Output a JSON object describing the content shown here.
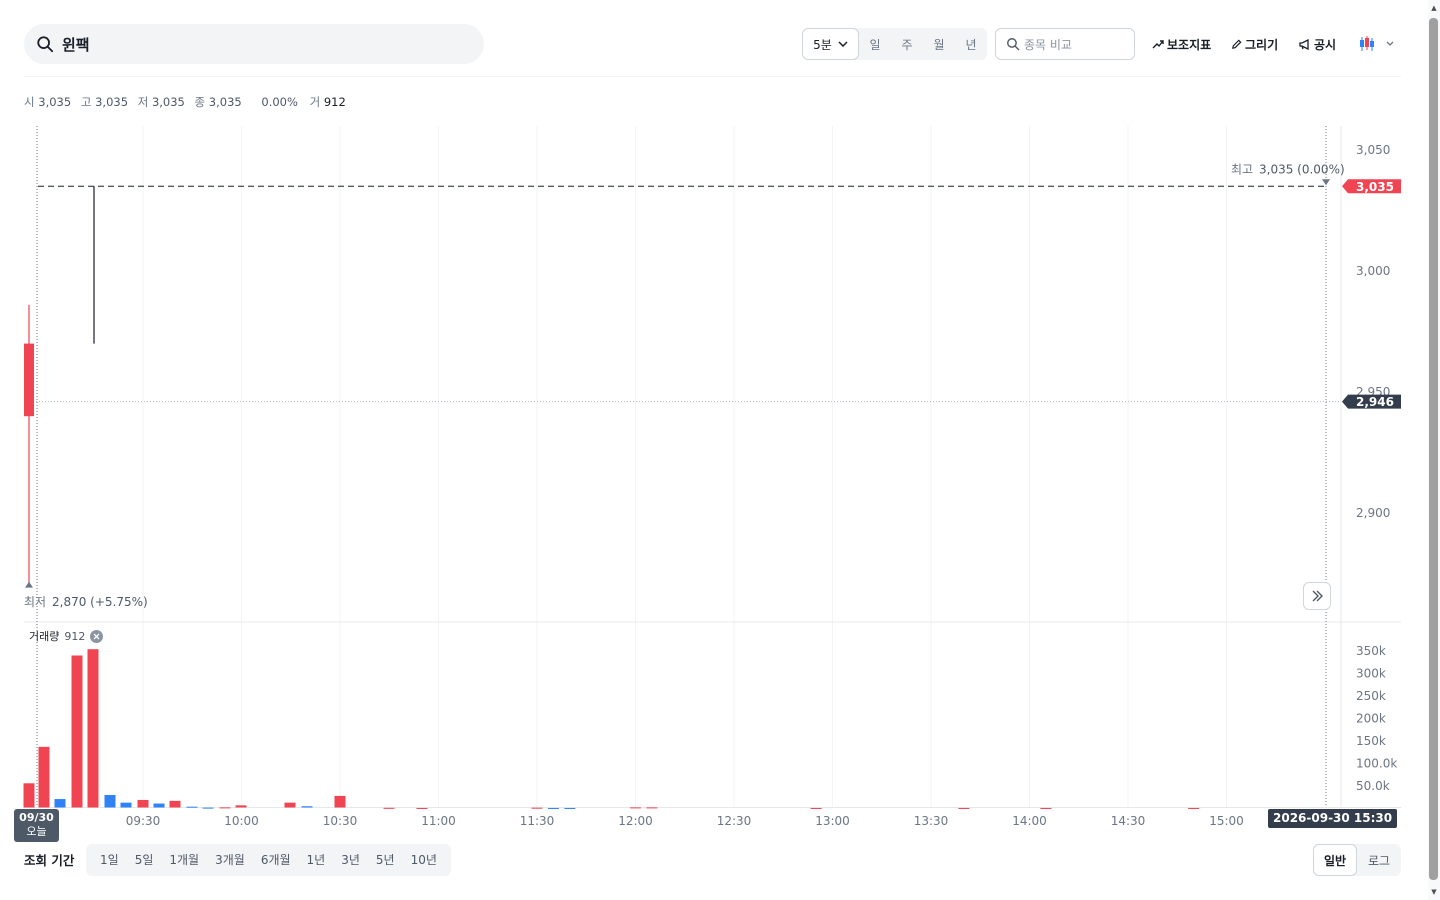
{
  "search": {
    "query": "윈팩"
  },
  "period": {
    "selected": "5분",
    "options": [
      "일",
      "주",
      "월",
      "년"
    ]
  },
  "compare": {
    "placeholder": "종목 비교"
  },
  "tools": {
    "indicator": "보조지표",
    "draw": "그리기",
    "disclosure": "공시"
  },
  "ohlc": {
    "open_label": "시",
    "open": "3,035",
    "high_label": "고",
    "high": "3,035",
    "low_label": "저",
    "low": "3,035",
    "close_label": "종",
    "close": "3,035",
    "change": "0.00%",
    "volume_label": "거",
    "volume": "912"
  },
  "chart_data": {
    "type": "candlestick",
    "price_axis": {
      "ticks": [
        {
          "value": 3050,
          "label": "3,050"
        },
        {
          "value": 3000,
          "label": "3,000"
        },
        {
          "value": 2950,
          "label": "2,950"
        },
        {
          "value": 2900,
          "label": "2,900"
        }
      ]
    },
    "current_price": {
      "value": 2946,
      "label": "2,946"
    },
    "high_marker": {
      "value": 3035,
      "label": "3,035",
      "annotation_label": "최고",
      "annotation_value": "3,035 (0.00%)"
    },
    "low_marker": {
      "value": 2870,
      "label_prefix": "최저",
      "label_value": "2,870 (+5.75%)"
    },
    "time_axis": [
      "09:30",
      "10:00",
      "10:30",
      "11:00",
      "11:30",
      "12:00",
      "12:30",
      "13:00",
      "13:30",
      "14:00",
      "14:30",
      "15:00"
    ],
    "candles": [
      {
        "time": "09:00",
        "open": 2970,
        "high": 2986,
        "low": 2870,
        "close": 2940,
        "color": "red"
      },
      {
        "time": "09:20",
        "open": 3035,
        "high": 3035,
        "low": 2970,
        "close": 3035,
        "color": "black"
      }
    ],
    "volume_axis": {
      "ticks": [
        {
          "value": 350000,
          "label": "350k"
        },
        {
          "value": 300000,
          "label": "300k"
        },
        {
          "value": 250000,
          "label": "250k"
        },
        {
          "value": 200000,
          "label": "200k"
        },
        {
          "value": 150000,
          "label": "150k"
        },
        {
          "value": 100000,
          "label": "100.0k"
        },
        {
          "value": 50000,
          "label": "50.0k"
        }
      ]
    },
    "volume_label": "거래량",
    "volume_value": "912",
    "volume": [
      {
        "time": "09:00",
        "value": 56000,
        "color": "red"
      },
      {
        "time": "09:05",
        "value": 137000,
        "color": "red"
      },
      {
        "time": "09:10",
        "value": 21000,
        "color": "blue"
      },
      {
        "time": "09:15",
        "value": 340000,
        "color": "red"
      },
      {
        "time": "09:20",
        "value": 354000,
        "color": "red"
      },
      {
        "time": "09:25",
        "value": 30000,
        "color": "blue"
      },
      {
        "time": "09:30",
        "value": 13000,
        "color": "blue"
      },
      {
        "time": "09:35",
        "value": 19000,
        "color": "red"
      },
      {
        "time": "09:40",
        "value": 11000,
        "color": "blue"
      },
      {
        "time": "09:45",
        "value": 17000,
        "color": "red"
      },
      {
        "time": "09:50",
        "value": 4000,
        "color": "blue"
      },
      {
        "time": "09:55",
        "value": 2000,
        "color": "blue"
      },
      {
        "time": "10:00",
        "value": 2500,
        "color": "red"
      },
      {
        "time": "10:00",
        "value": 7000,
        "color": "red"
      },
      {
        "time": "10:15",
        "value": 13000,
        "color": "red"
      },
      {
        "time": "10:20",
        "value": 5000,
        "color": "blue"
      },
      {
        "time": "10:30",
        "value": 28000,
        "color": "red"
      },
      {
        "time": "10:40",
        "value": 1500,
        "color": "red"
      },
      {
        "time": "10:50",
        "value": 1200,
        "color": "red"
      },
      {
        "time": "11:30",
        "value": 1800,
        "color": "red"
      },
      {
        "time": "11:35",
        "value": 1200,
        "color": "blue"
      },
      {
        "time": "11:40",
        "value": 1200,
        "color": "blue"
      },
      {
        "time": "12:00",
        "value": 2500,
        "color": "red"
      },
      {
        "time": "12:05",
        "value": 2500,
        "color": "red"
      },
      {
        "time": "12:55",
        "value": 1200,
        "color": "red"
      },
      {
        "time": "13:40",
        "value": 1200,
        "color": "red"
      },
      {
        "time": "14:05",
        "value": 1200,
        "color": "red"
      },
      {
        "time": "14:50",
        "value": 1200,
        "color": "red"
      }
    ],
    "date_badge": {
      "date": "09/30",
      "sub": "오늘"
    },
    "crosshair_time": "2026-09-30 15:30",
    "colors": {
      "up": "#f04452",
      "down": "#3182f6",
      "grid": "#f2f4f6",
      "axis_text": "#6b7684",
      "dark_badge": "#333d4b"
    }
  },
  "range": {
    "label": "조회 기간",
    "options": [
      "1일",
      "5일",
      "1개월",
      "3개월",
      "6개월",
      "1년",
      "3년",
      "5년",
      "10년"
    ]
  },
  "scale": {
    "normal": "일반",
    "log": "로그"
  }
}
